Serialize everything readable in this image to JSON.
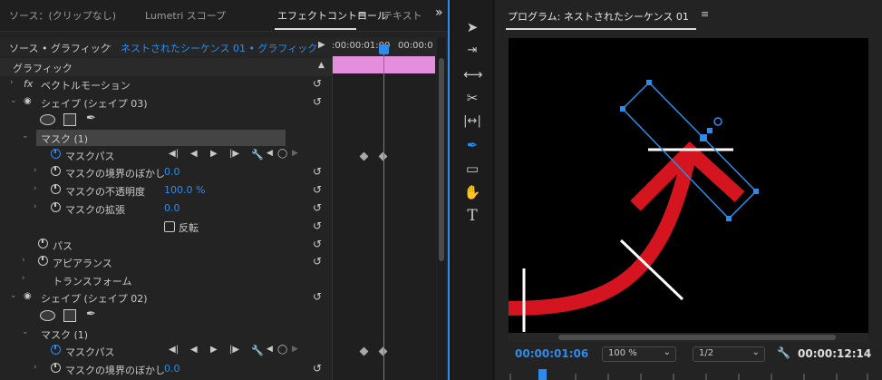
{
  "left_tabs": {
    "source": "ソース：(クリップなし)",
    "lumetri": "Lumetri スコープ",
    "effect_controls": "エフェクトコントロール",
    "effect_controls_menu": "≡",
    "text": "テキスト",
    "overflow": "»"
  },
  "source_row": {
    "source_label": "ソース • グラフィック",
    "sequence_label": "ネストされたシーケンス 01 • グラフィック",
    "time_start": ":00:00:01:00",
    "time_end": "00:00:0"
  },
  "properties": {
    "graphic": "グラフィック",
    "fx": "fx",
    "vector_motion": "ベクトルモーション",
    "shape3": "シェイプ (シェイプ 03)",
    "mask1": "マスク (1)",
    "mask_path": "マスクパス",
    "mask_feather": "マスクの境界のぼかし",
    "mask_feather_value": "0.0",
    "mask_opacity": "マスクの不透明度",
    "mask_opacity_value": "100.0 %",
    "mask_expansion": "マスクの拡張",
    "mask_expansion_value": "0.0",
    "inverted": "反転",
    "path": "パス",
    "appearance": "アピアランス",
    "transform": "トランスフォーム",
    "shape2": "シェイプ (シェイプ 02)",
    "mask1_b": "マスク (1)",
    "mask_path_b": "マスクパス",
    "mask_feather_b": "マスクの境界のぼかし",
    "mask_feather_b_value": "0.0"
  },
  "program": {
    "title": "プログラム: ネストされたシーケンス 01",
    "menu": "≡",
    "timecode": "00:00:01:06",
    "zoom": "100 %",
    "resolution": "1/2",
    "duration": "00:00:12:14"
  },
  "colors": {
    "accent": "#2d8ceb",
    "clip": "#e48fde",
    "arrow": "#d4151f"
  }
}
